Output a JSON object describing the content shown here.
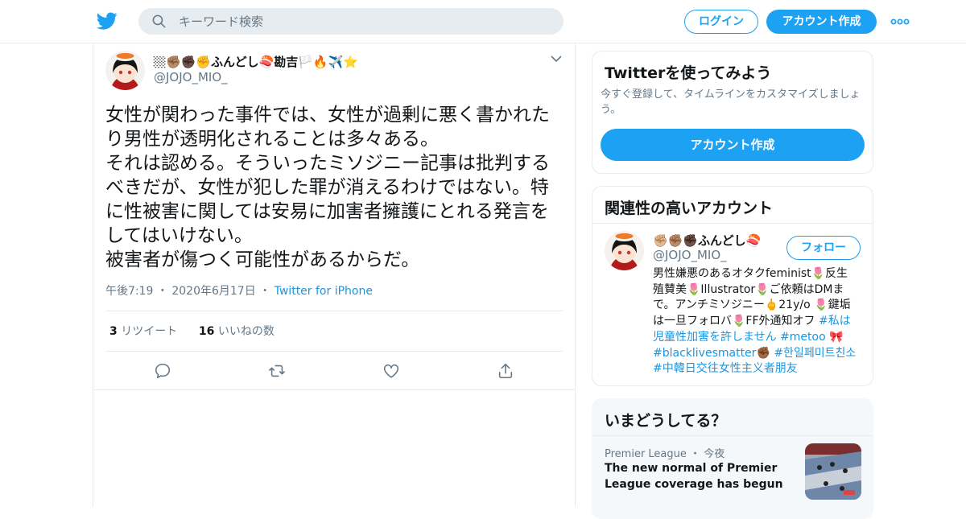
{
  "header": {
    "search_placeholder": "キーワード検索",
    "login_label": "ログイン",
    "signup_label": "アカウント作成",
    "brand_color": "#1da1f2"
  },
  "tweet": {
    "display_name": "🏼✊🏽✊🏿✊ふんどし🍣勘吉🏳️🔥✈️⭐",
    "handle": "@JOJO_MIO_",
    "text": "女性が関わった事件では、女性が過剰に悪く書かれたり男性が透明化されることは多々ある。\nそれは認める。そういったミソジニー記事は批判するべきだが、女性が犯した罪が消えるわけではない。特に性被害に関しては安易に加害者擁護にとれる発言をしてはいけない。\n被害者が傷つく可能性があるからだ。",
    "time": "午後7:19",
    "date": "2020年6月17日",
    "source": "Twitter for iPhone",
    "retweets_count": "3",
    "retweets_label": "リツイート",
    "likes_count": "16",
    "likes_label": "いいねの数"
  },
  "signup_card": {
    "title": "Twitterを使ってみよう",
    "description": "今すぐ登録して、タイムラインをカスタマイズしましょう。",
    "button_label": "アカウント作成"
  },
  "related_card": {
    "title": "関連性の高いアカウント",
    "display_name": "✊🏼✊🏽✊🏿ふんどし🍣",
    "handle": "@JOJO_MIO_",
    "follow_label": "フォロー",
    "bio_text": "男性嫌悪のあるオタクfeminist🌷反生殖賛美🌷Illustrator🌷ご依頼はDMまで。アンチミソジニー🖕21y/o 🌷鍵垢は一旦フォロバ🌷FF外通知オフ ",
    "hashtag_1": "#私は児童性加害を許しません",
    "hashtag_2": "#metoo",
    "hashtag_3": "#blacklivesmatter",
    "hashtag_4": "#한일페미트친소",
    "hashtag_5": "#中韓日交往女性主义者朋友"
  },
  "trends_card": {
    "title": "いまどうしてる？",
    "item_source": "Premier League",
    "item_time": "今夜",
    "item_headline": "The new normal of Premier League coverage has begun"
  }
}
